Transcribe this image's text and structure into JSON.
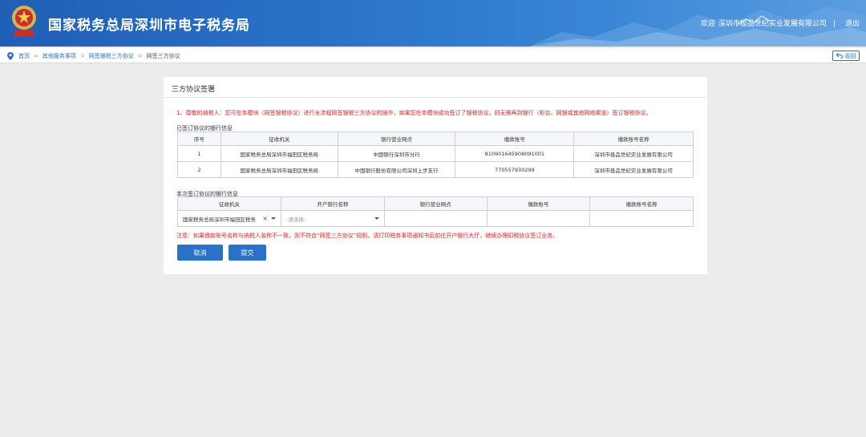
{
  "header": {
    "title": "国家税务总局深圳市电子税务局",
    "welcome": "欢迎",
    "company": "深圳市极品世纪实业发展有限公司",
    "separator": "|",
    "logout": "退出"
  },
  "breadcrumb": {
    "items": [
      "首页",
      "其他服务事项",
      "网签银税三方协议"
    ],
    "current": "网签三方协议",
    "separator": ">",
    "back_label": "返回"
  },
  "panel": {
    "title": "三方协议签署",
    "notice": "1、尊敬的纳税人：您可在本模块（网签银税协议）进行全流程网签银税三方协议的操作，如果您在本模块成功签订了银税协议，则无需再到银行（柜台、网银或其他网络渠道）签订银税协议。",
    "signed_label": "已签订协议的银行信息",
    "signed_table": {
      "headers": [
        "序号",
        "征收机关",
        "银行营业网点",
        "缴款账号",
        "缴款账号名称"
      ],
      "rows": [
        [
          "1",
          "国家税务总局深圳市福田区税务局",
          "中国银行深圳市分行",
          "810901645908091001",
          "深圳市极品世纪实业发展有限公司"
        ],
        [
          "2",
          "国家税务总局深圳市福田区税务局",
          "中国银行股份有限公司深圳上步支行",
          "770557930299",
          "深圳市极品世纪实业发展有限公司"
        ]
      ]
    },
    "new_label": "本次签订协议的银行信息",
    "new_table": {
      "headers": [
        "征收机关",
        "开户银行名称",
        "银行营业网点",
        "缴款账号",
        "缴款账号名称"
      ],
      "tax_office_value": "国家税务总局深圳市福田区税务",
      "bank_placeholder": "-请选择-"
    },
    "warning": "注意：如果缴款账号名称与纳税人名称不一致，则不符合“网签三方协议”规则，请打印税务事项通知书后前往开户银行大厅，继续办理扣税协议签订业务。",
    "cancel_label": "取消",
    "submit_label": "提交"
  },
  "colors": {
    "brand_blue": "#2a72c8",
    "warning_red": "#e02020"
  },
  "icons": [
    "emblem-icon",
    "location-icon",
    "back-icon",
    "clear-icon",
    "dropdown-icon"
  ]
}
